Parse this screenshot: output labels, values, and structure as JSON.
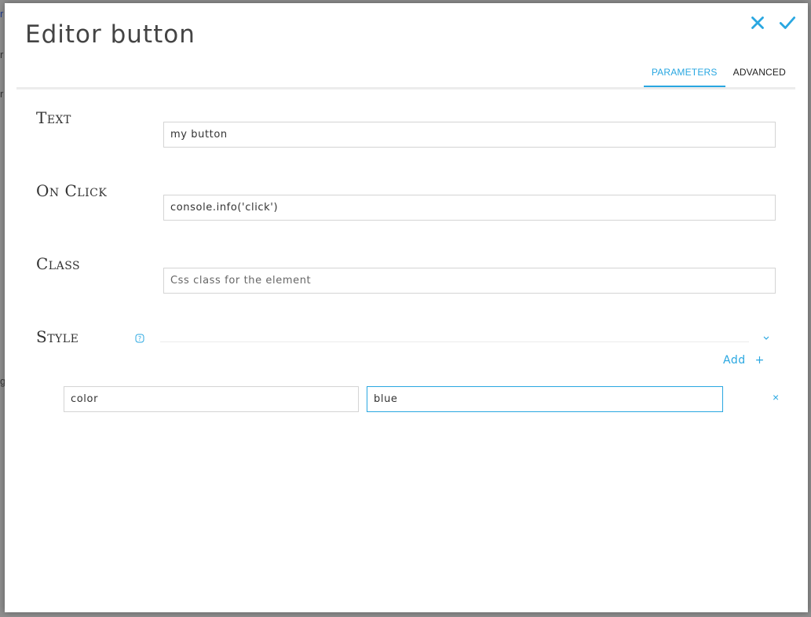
{
  "background": {
    "glyphs": [
      "r",
      "r",
      "r",
      "g"
    ]
  },
  "modal": {
    "title": "Editor button",
    "actions": {
      "close_icon": "close-icon",
      "confirm_icon": "check-icon"
    },
    "tabs": [
      {
        "label": "PARAMETERS",
        "active": true
      },
      {
        "label": "ADVANCED",
        "active": false
      }
    ],
    "accent_color": "#29a7e1"
  },
  "fields": {
    "text": {
      "label": "Text",
      "value": "my button",
      "placeholder": ""
    },
    "onclick": {
      "label": "On Click",
      "value": "console.info('click')",
      "placeholder": ""
    },
    "class": {
      "label": "Class",
      "value": "",
      "placeholder": "Css class for the element"
    },
    "style": {
      "label": "Style",
      "help_icon": "help-icon",
      "add_label": "Add",
      "add_plus": "+",
      "rows": [
        {
          "key": "color",
          "value": "blue",
          "remove": "×"
        }
      ]
    }
  }
}
